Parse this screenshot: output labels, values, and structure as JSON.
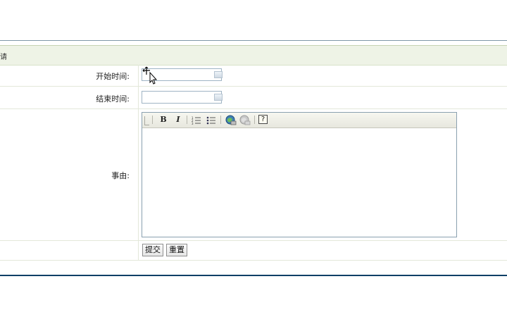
{
  "form": {
    "header_title": "请",
    "start_label": "开始时间:",
    "end_label": "结束时间:",
    "reason_label": "事由:",
    "start_value": "",
    "end_value": ""
  },
  "editor": {
    "toolbar": {
      "bold_label": "B",
      "italic_label": "I",
      "help_label": "?"
    }
  },
  "actions": {
    "submit_label": "提交",
    "reset_label": "重置"
  },
  "icons": {
    "calendar": "calendar-icon",
    "ordered_list": "ordered-list-icon",
    "unordered_list": "unordered-list-icon",
    "link": "link-icon",
    "unlink": "unlink-icon",
    "help": "help-icon"
  },
  "colors": {
    "header_band": "#eef3e6",
    "bottom_rule": "#0f3f66",
    "toolbar": "#ecece3"
  }
}
